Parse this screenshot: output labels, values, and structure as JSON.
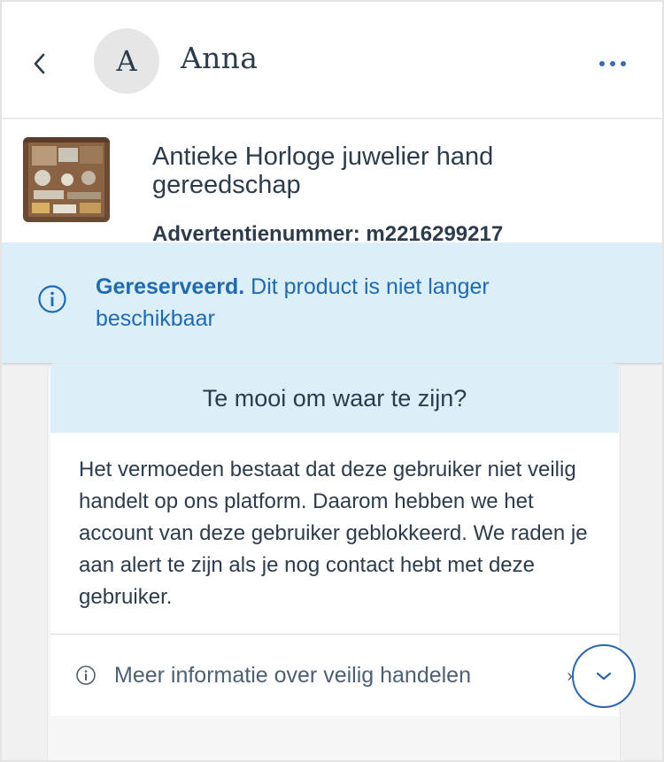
{
  "header": {
    "back_icon": "chevron-left-icon",
    "avatar_initial": "A",
    "username": "Anna",
    "more_icon": "more-horizontal-icon",
    "accent_color": "#3a6cb0"
  },
  "listing": {
    "title": "Antieke Horloge juwelier hand gereedschap",
    "ad_number": "Advertentienummer: m2216299217"
  },
  "reserved_banner": {
    "icon": "info-circle-icon",
    "status": "Gereserveerd.",
    "message": "Dit product is niet langer beschikbaar",
    "color": "#1f6ab0",
    "background": "#dceef8"
  },
  "warning_card": {
    "title": "Te mooi om waar te zijn?",
    "body": "Het vermoeden bestaat dat deze gebruiker niet veilig handelt op ons platform. Daarom hebben we het account van deze gebruiker geblokkeerd. We raden je aan alert te zijn als je nog contact hebt met deze gebruiker.",
    "link_icon": "info-circle-icon",
    "link_text": "Meer informatie over veilig handelen",
    "link_arrow_icon": "chevron-right-icon"
  },
  "scroll_button": {
    "icon": "chevron-down-icon",
    "color": "#2a66ac"
  }
}
